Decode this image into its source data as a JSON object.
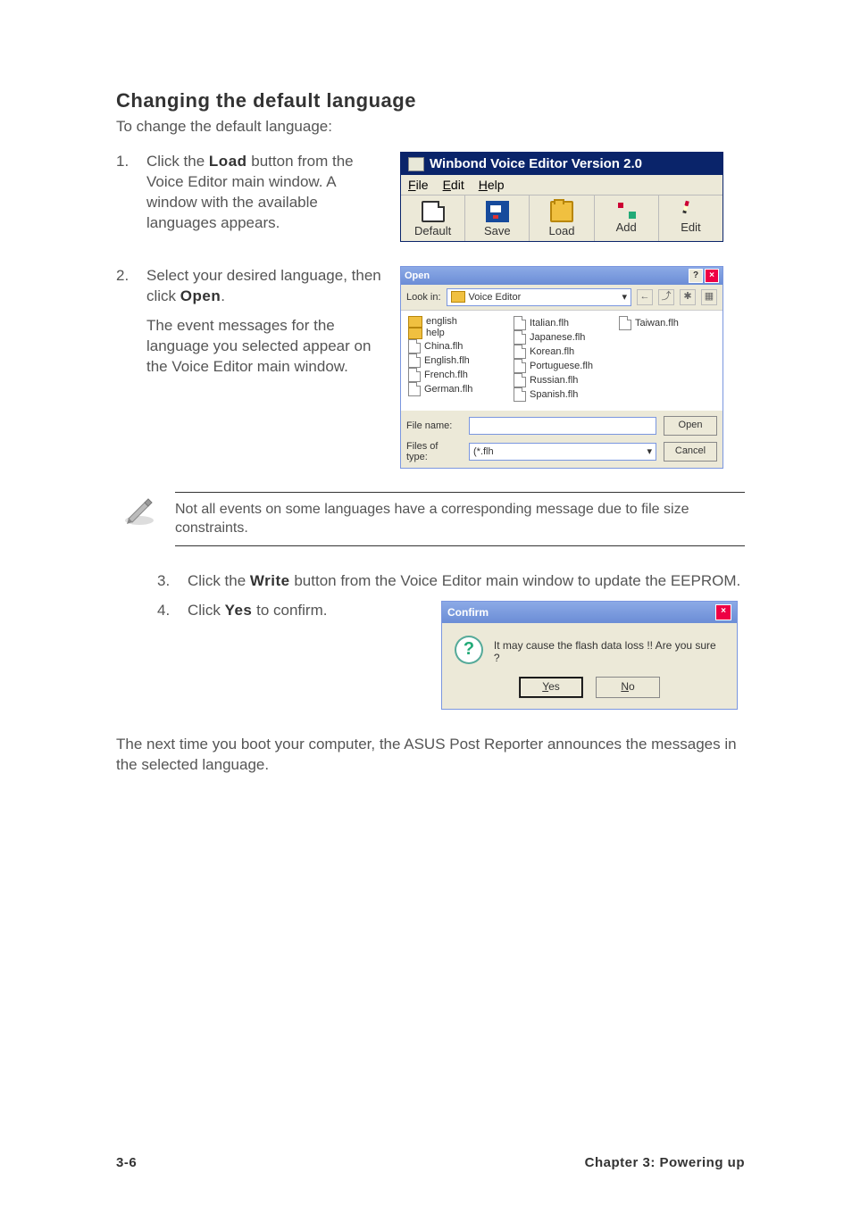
{
  "heading": "Changing the default language",
  "intro": "To change the default language:",
  "steps": {
    "s1": {
      "num": "1.",
      "l1a": "Click the ",
      "l1b": "Load",
      "l1c": " button from the Voice Editor main window. A window with the available languages appears."
    },
    "s2": {
      "num": "2.",
      "l2a": "Select your desired language, then click ",
      "l2b": "Open",
      "l2c": ".",
      "l2d": "The event messages for the language you selected appear on the Voice Editor main window."
    },
    "s3": {
      "num": "3.",
      "l3a": "Click the ",
      "l3b": "Write",
      "l3c": " button from the Voice Editor main window to update the EEPROM."
    },
    "s4": {
      "num": "4.",
      "l4a": "Click ",
      "l4b": "Yes",
      "l4c": " to confirm."
    }
  },
  "note": "Not all events on some languages have a corresponding message due to file size constraints.",
  "closing": "The next time you boot your computer, the ASUS Post Reporter announces the messages in the selected language.",
  "footer": {
    "left": "3-6",
    "right": "Chapter 3: Powering up"
  },
  "winbond": {
    "title": "Winbond Voice Editor  Version 2.0",
    "menu": {
      "file": "File",
      "edit": "Edit",
      "help": "Help"
    },
    "tools": {
      "default": "Default",
      "save": "Save",
      "load": "Load",
      "add": "Add",
      "edit": "Edit"
    }
  },
  "opendlg": {
    "title": "Open",
    "lookin_label": "Look in:",
    "lookin_value": "Voice Editor",
    "files_col1": [
      "english",
      "help",
      "China.flh",
      "English.flh",
      "French.flh",
      "German.flh"
    ],
    "files_col2": [
      "Italian.flh",
      "Japanese.flh",
      "Korean.flh",
      "Portuguese.flh",
      "Russian.flh",
      "Spanish.flh"
    ],
    "files_col3": [
      "Taiwan.flh"
    ],
    "filename_label": "File name:",
    "filename_value": "",
    "filesoftype_label": "Files of type:",
    "filesoftype_value": "(*.flh",
    "open_btn": "Open",
    "cancel_btn": "Cancel"
  },
  "confirm": {
    "title": "Confirm",
    "msg": "It may cause the flash data loss !!  Are you sure ?",
    "yes": "Yes",
    "no": "No"
  }
}
